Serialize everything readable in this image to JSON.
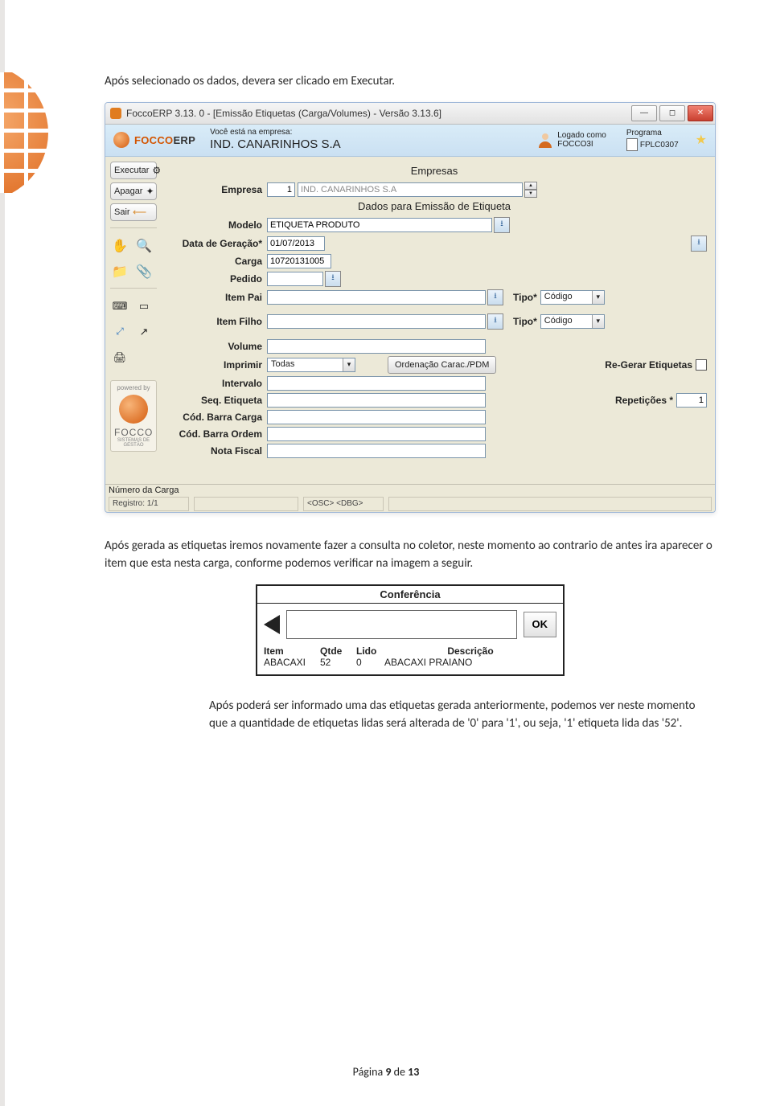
{
  "intro": "Após selecionado os dados, devera ser clicado em Executar.",
  "titlebar": "FoccoERP  3.13.  0 - [Emissão Etiquetas (Carga/Volumes) - Versão 3.13.6]",
  "brand1": "FOCCO",
  "brand2": "ERP",
  "hdr_label": "Você está na empresa:",
  "hdr_company": "IND. CANARINHOS S.A",
  "user_lbl": "Logado como",
  "user_val": "FOCCO3I",
  "prog_lbl": "Programa",
  "prog_val": "FPLC0307",
  "sidebar": {
    "exec": "Executar",
    "clear": "Apagar",
    "exit": "Sair",
    "powered": "powered by",
    "focco": "FOCCO",
    "sys": "SISTEMAS DE GESTÃO"
  },
  "sec1": "Empresas",
  "sec2": "Dados para Emissão de Etiqueta",
  "f": {
    "empresa_l": "Empresa",
    "empresa_num": "1",
    "empresa_nome": "IND. CANARINHOS S.A",
    "modelo_l": "Modelo",
    "modelo_v": "ETIQUETA PRODUTO",
    "data_l": "Data de Geração*",
    "data_v": "01/07/2013",
    "carga_l": "Carga",
    "carga_v": "10720131005",
    "pedido_l": "Pedido",
    "itempai_l": "Item Pai",
    "tipo_l": "Tipo*",
    "tipo_v": "Código",
    "itemfilho_l": "Item Filho",
    "volume_l": "Volume",
    "imprimir_l": "Imprimir",
    "imprimir_v": "Todas",
    "pdm": "Ordenação Carac./PDM",
    "reger": "Re-Gerar Etiquetas",
    "intervalo_l": "Intervalo",
    "seq_l": "Seq. Etiqueta",
    "rep_l": "Repetições *",
    "rep_v": "1",
    "cbc_l": "Cód. Barra Carga",
    "cbo_l": "Cód. Barra Ordem",
    "nf_l": "Nota Fiscal"
  },
  "status": {
    "num": "Número da Carga",
    "reg": "Registro: 1/1",
    "osc": "<OSC> <DBG>"
  },
  "para2": "Após gerada as etiquetas iremos novamente fazer a consulta no coletor, neste momento ao contrario de antes ira aparecer o item que esta nesta carga, conforme podemos verificar na imagem a seguir.",
  "conf": {
    "title": "Conferência",
    "ok": "OK",
    "h_item": "Item",
    "h_qtde": "Qtde",
    "h_lido": "Lido",
    "h_desc": "Descrição",
    "r_item": "ABACAXI",
    "r_qtde": "52",
    "r_lido": "0",
    "r_desc": "ABACAXI PRAIANO"
  },
  "para3": "Após poderá ser informado uma das etiquetas gerada anteriormente, podemos ver neste momento que a quantidade de etiquetas lidas será alterada de '0' para '1', ou seja, '1' etiqueta lida das '52'.",
  "footer_pre": "Página ",
  "footer_pg": "9",
  "footer_mid": " de ",
  "footer_tot": "13"
}
